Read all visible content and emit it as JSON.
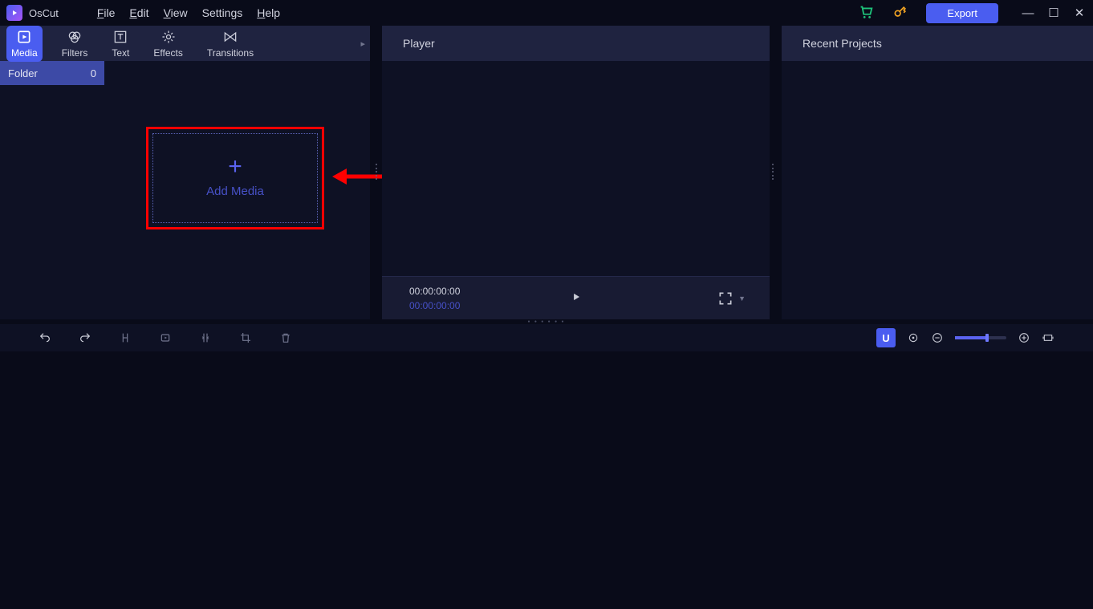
{
  "app": {
    "title": "OsCut"
  },
  "menu": {
    "file": "File",
    "edit": "Edit",
    "view": "View",
    "settings": "Settings",
    "help": "Help"
  },
  "titlebar": {
    "export": "Export"
  },
  "tabs": {
    "media": "Media",
    "filters": "Filters",
    "text": "Text",
    "effects": "Effects",
    "transitions": "Transitions"
  },
  "folder": {
    "label": "Folder",
    "count": "0"
  },
  "add_media": {
    "label": "Add Media"
  },
  "player": {
    "title": "Player",
    "time_current": "00:00:00:00",
    "time_total": "00:00:00:00"
  },
  "recent": {
    "title": "Recent Projects"
  },
  "snap": {
    "label": "U"
  }
}
